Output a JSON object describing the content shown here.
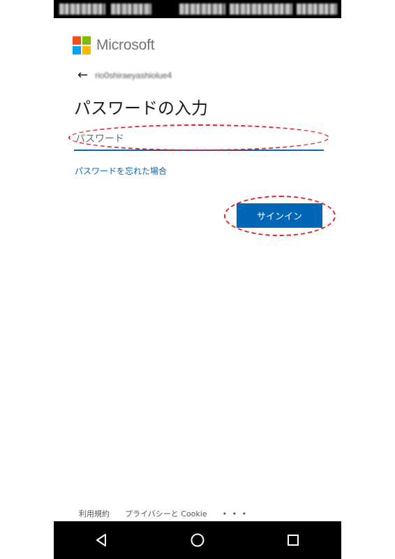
{
  "brand": {
    "name": "Microsoft",
    "logo_colors": [
      "#f25022",
      "#7fba00",
      "#00a4ef",
      "#ffb900"
    ]
  },
  "account": {
    "email": "rio0shiraeyashiolue4"
  },
  "page": {
    "heading": "パスワードの入力"
  },
  "password_field": {
    "placeholder": "パスワード",
    "value": ""
  },
  "links": {
    "forgot_password": "パスワードを忘れた場合"
  },
  "buttons": {
    "signin": "サインイン"
  },
  "footer": {
    "terms": "利用規約",
    "privacy": "プライバシーと Cookie",
    "more": "• • •"
  },
  "colors": {
    "accent": "#0067b8",
    "annotation": "#e41e26"
  },
  "icons": {
    "back": "arrow-left",
    "nav": [
      "back-triangle",
      "home-circle",
      "recents-square"
    ]
  }
}
